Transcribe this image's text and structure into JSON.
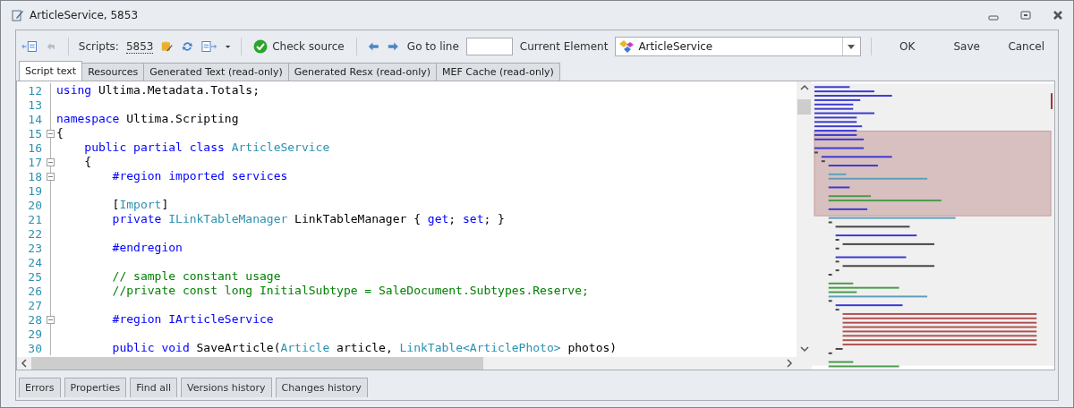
{
  "window": {
    "title": "ArticleService, 5853"
  },
  "toolbar": {
    "scripts_label": "Scripts:",
    "scripts_link": "5853",
    "check_button": "Check source",
    "goto_label": "Go to line",
    "element_label": "Current Element",
    "element_value": "ArticleService",
    "actions": [
      "OK",
      "Save",
      "Cancel"
    ]
  },
  "tabs": [
    {
      "label": "Script text",
      "selected": true
    },
    {
      "label": "Resources",
      "selected": false
    },
    {
      "label": "Generated Text (read-only)",
      "selected": false
    },
    {
      "label": "Generated Resx (read-only)",
      "selected": false
    },
    {
      "label": "MEF Cache (read-only)",
      "selected": false
    }
  ],
  "code_lines": [
    {
      "number": "12",
      "fold": false,
      "tokens": [
        {
          "kind": "keyword",
          "text": "using"
        },
        {
          "kind": "plain",
          "text": " Ultima.Metadata.Totals;"
        }
      ]
    },
    {
      "number": "13",
      "fold": false
    },
    {
      "number": "14",
      "fold": false,
      "tokens": [
        {
          "kind": "keyword",
          "text": "namespace"
        },
        {
          "kind": "plain",
          "text": " Ultima.Scripting"
        }
      ]
    },
    {
      "number": "15",
      "fold": true,
      "tokens": [
        {
          "kind": "plain",
          "text": "{"
        }
      ]
    },
    {
      "number": "16",
      "fold": false,
      "tokens": [
        {
          "kind": "keyword",
          "text": "    public partial class "
        },
        {
          "kind": "type",
          "text": "ArticleService"
        }
      ]
    },
    {
      "number": "17",
      "fold": true,
      "tokens": [
        {
          "kind": "plain",
          "text": "    {"
        }
      ]
    },
    {
      "number": "18",
      "fold": true,
      "tokens": [
        {
          "kind": "keyword",
          "text": "        #region imported services"
        }
      ]
    },
    {
      "number": "19",
      "fold": false
    },
    {
      "number": "20",
      "fold": false,
      "tokens": [
        {
          "kind": "plain",
          "text": "        ["
        },
        {
          "kind": "type",
          "text": "Import"
        },
        {
          "kind": "plain",
          "text": "]"
        }
      ]
    },
    {
      "number": "21",
      "fold": false,
      "tokens": [
        {
          "kind": "keyword",
          "text": "        private "
        },
        {
          "kind": "type",
          "text": "ILinkTableManager"
        },
        {
          "kind": "plain",
          "text": " LinkTableManager { "
        },
        {
          "kind": "keyword",
          "text": "get"
        },
        {
          "kind": "plain",
          "text": "; "
        },
        {
          "kind": "keyword",
          "text": "set"
        },
        {
          "kind": "plain",
          "text": "; }"
        }
      ]
    },
    {
      "number": "22",
      "fold": false
    },
    {
      "number": "23",
      "fold": false,
      "tokens": [
        {
          "kind": "keyword",
          "text": "        #endregion"
        }
      ]
    },
    {
      "number": "24",
      "fold": false
    },
    {
      "number": "25",
      "fold": false,
      "tokens": [
        {
          "kind": "comment",
          "text": "        // sample constant usage"
        }
      ]
    },
    {
      "number": "26",
      "fold": false,
      "tokens": [
        {
          "kind": "comment",
          "text": "        //private const long InitialSubtype = SaleDocument.Subtypes.Reserve;"
        }
      ]
    },
    {
      "number": "27",
      "fold": false
    },
    {
      "number": "28",
      "fold": true,
      "tokens": [
        {
          "kind": "keyword",
          "text": "        #region IArticleService"
        }
      ]
    },
    {
      "number": "29",
      "fold": false
    },
    {
      "number": "30",
      "fold": false,
      "tokens": [
        {
          "kind": "keyword",
          "text": "        public void"
        },
        {
          "kind": "plain",
          "text": " SaveArticle("
        },
        {
          "kind": "type",
          "text": "Article"
        },
        {
          "kind": "plain",
          "text": " article, "
        },
        {
          "kind": "type",
          "text": "LinkTable<ArticlePhoto>"
        },
        {
          "kind": "plain",
          "text": " photos)"
        }
      ]
    }
  ],
  "bottom_tabs": [
    {
      "label": "Errors",
      "selected": false
    },
    {
      "label": "Properties",
      "selected": false
    },
    {
      "label": "Find all",
      "selected": false
    },
    {
      "label": "Versions history",
      "selected": false
    },
    {
      "label": "Changes history",
      "selected": false
    }
  ]
}
